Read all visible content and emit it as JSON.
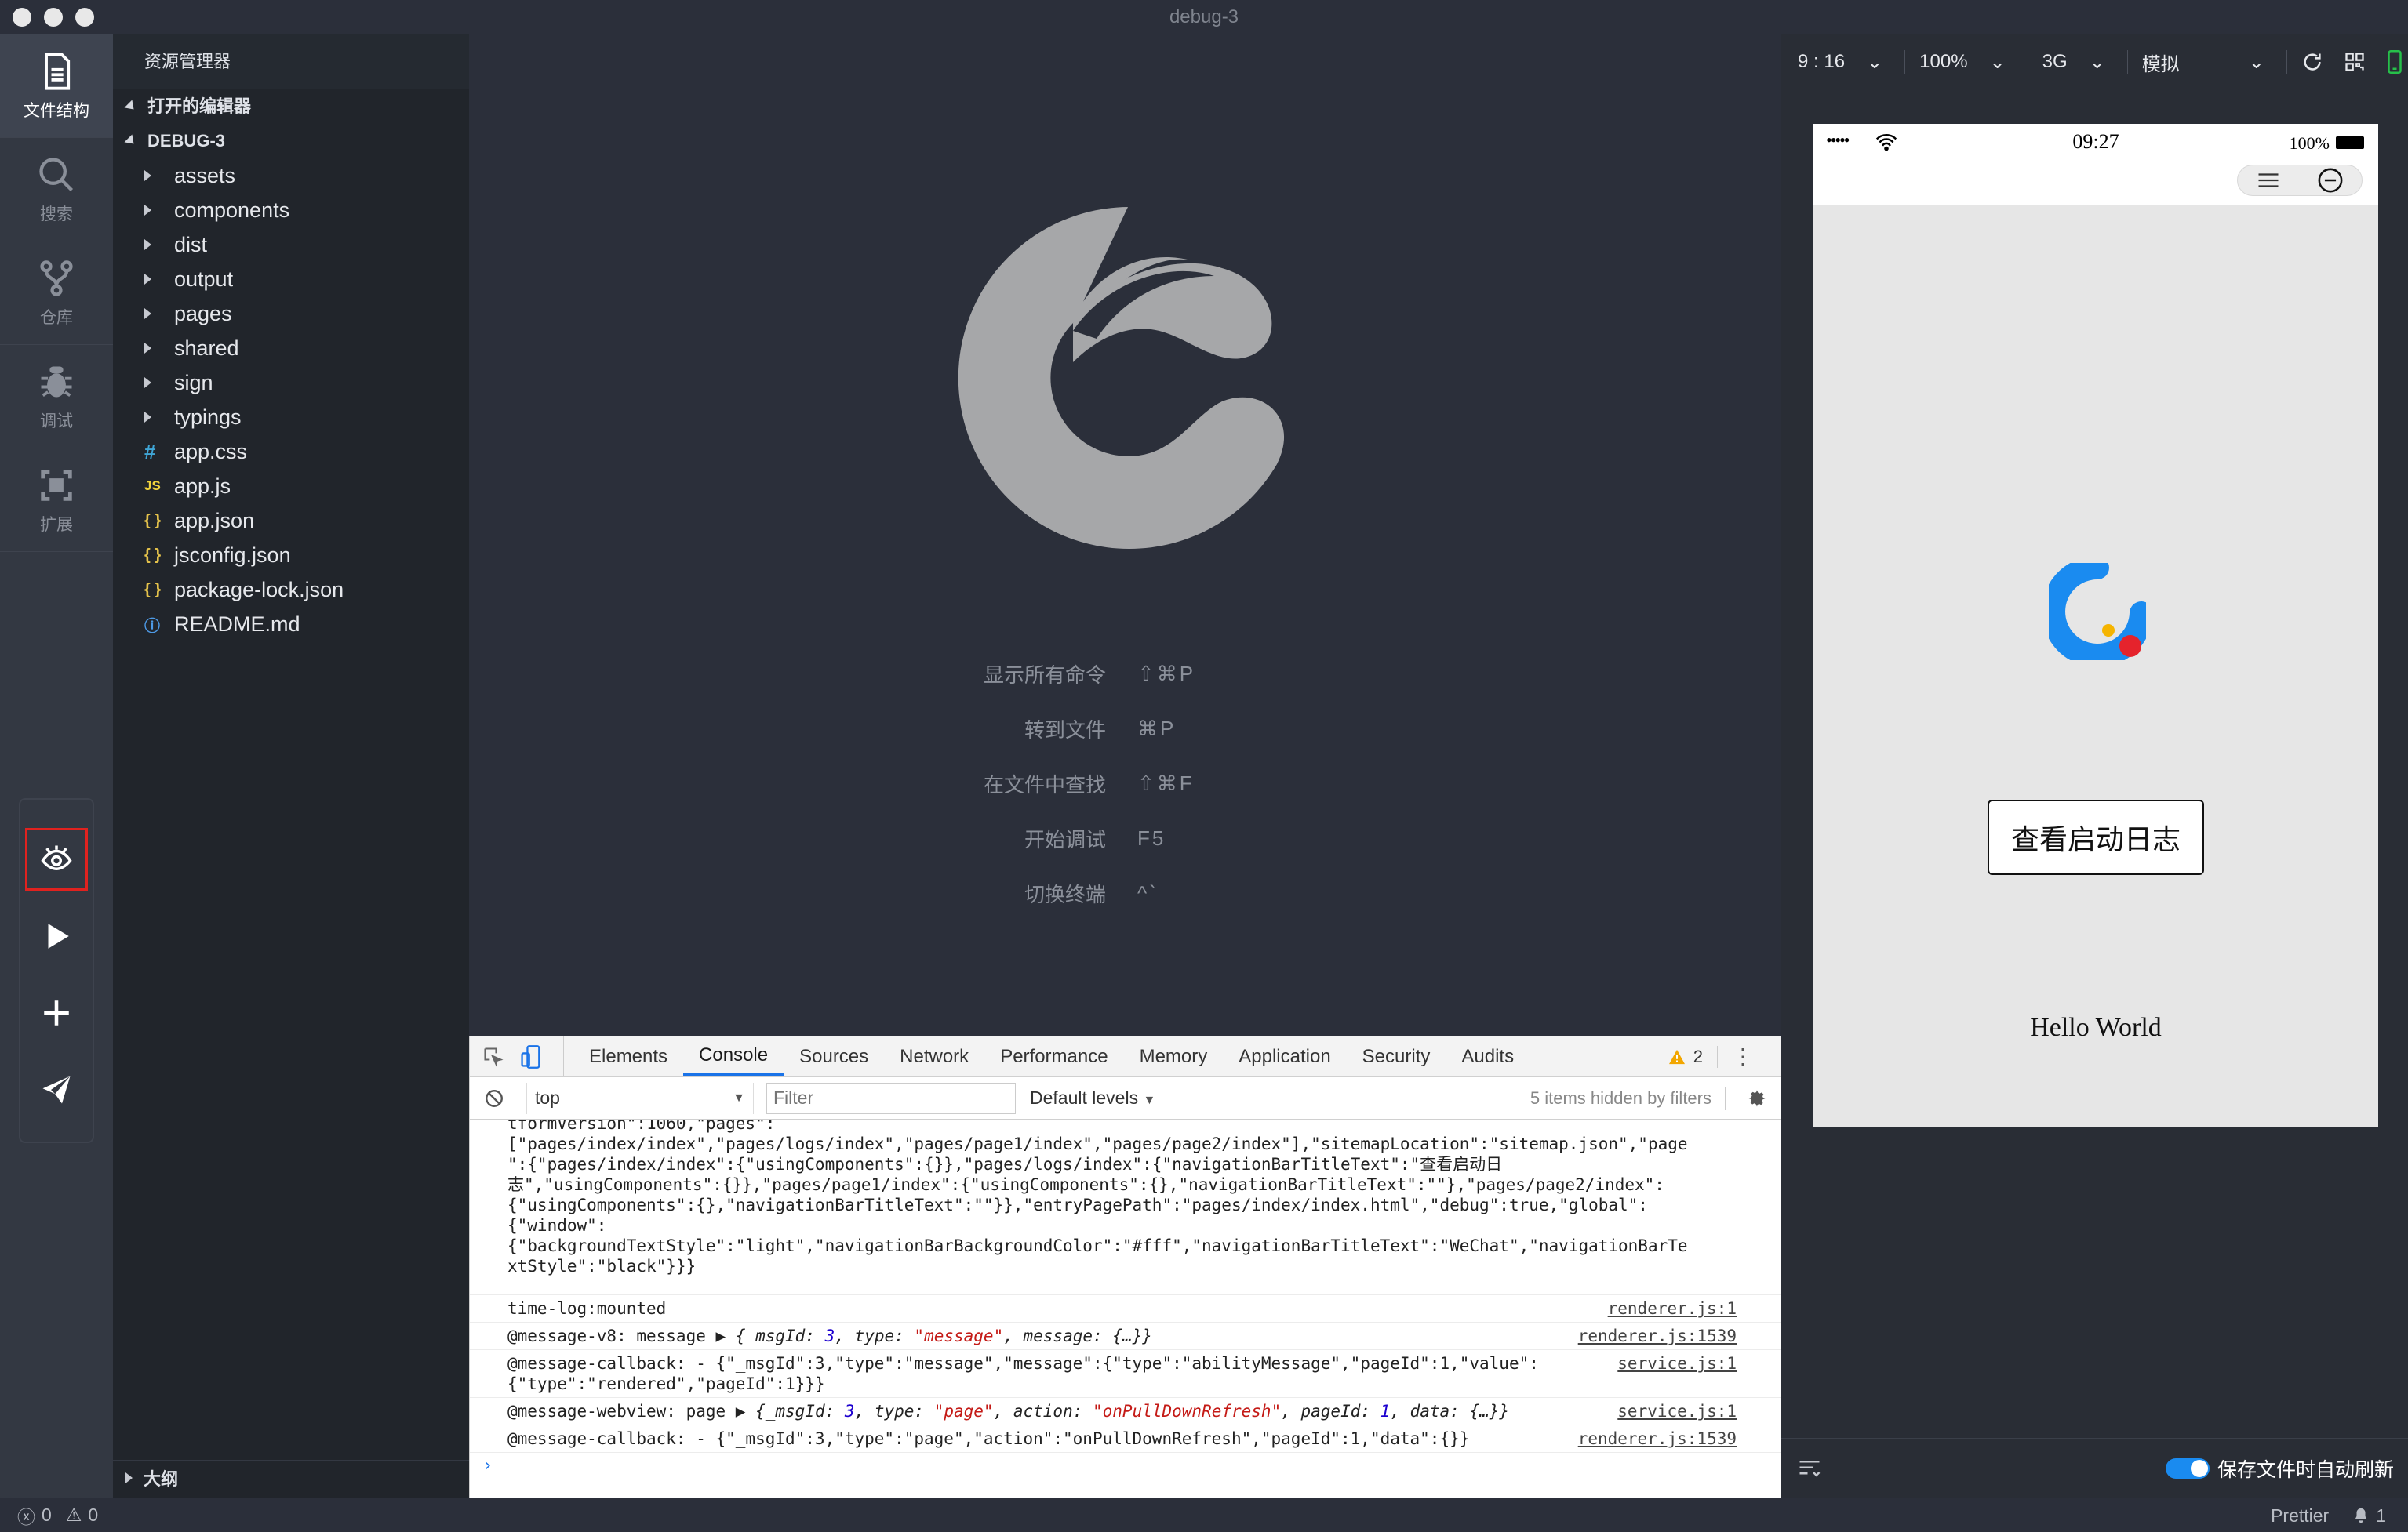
{
  "window": {
    "title": "debug-3"
  },
  "activity_bar": {
    "items": [
      {
        "label": "文件结构",
        "icon": "file-icon"
      },
      {
        "label": "搜索",
        "icon": "search-icon"
      },
      {
        "label": "仓库",
        "icon": "branch-icon"
      },
      {
        "label": "调试",
        "icon": "bug-icon"
      },
      {
        "label": "扩展",
        "icon": "extension-icon"
      }
    ],
    "tools": [
      "eye-icon",
      "play-icon",
      "plus-icon",
      "send-icon"
    ]
  },
  "explorer": {
    "header": "资源管理器",
    "open_editors": "打开的编辑器",
    "project": "DEBUG-3",
    "folders": [
      "assets",
      "components",
      "dist",
      "output",
      "pages",
      "shared",
      "sign",
      "typings"
    ],
    "files": [
      {
        "name": "app.css",
        "badge": "#"
      },
      {
        "name": "app.js",
        "badge": "JS"
      },
      {
        "name": "app.json",
        "badge": "{ }"
      },
      {
        "name": "jsconfig.json",
        "badge": "{ }"
      },
      {
        "name": "package-lock.json",
        "badge": "{ }"
      },
      {
        "name": "README.md",
        "badge": "ⓘ"
      }
    ],
    "outline": "大纲"
  },
  "welcome": {
    "commands": [
      {
        "label": "显示所有命令",
        "key": "⇧⌘P"
      },
      {
        "label": "转到文件",
        "key": "⌘P"
      },
      {
        "label": "在文件中查找",
        "key": "⇧⌘F"
      },
      {
        "label": "开始调试",
        "key": "F5"
      },
      {
        "label": "切换终端",
        "key": "^`"
      }
    ]
  },
  "devtools": {
    "tabs": [
      "Elements",
      "Console",
      "Sources",
      "Network",
      "Performance",
      "Memory",
      "Application",
      "Security",
      "Audits"
    ],
    "active_tab": "Console",
    "warning_count": "2",
    "context": "top",
    "filter_placeholder": "Filter",
    "levels": "Default levels",
    "hidden_note": "5 items hidden by filters",
    "logs": {
      "l1_a": "tformVersion\":1060,\"pages\":",
      "l1_b": "[\"pages/index/index\",\"pages/logs/index\",\"pages/page1/index\",\"pages/page2/index\"],\"sitemapLocation\":\"sitemap.json\",\"page\n\":{\"pages/index/index\":{\"usingComponents\":{}},\"pages/logs/index\":{\"navigationBarTitleText\":\"查看启动日\n志\",\"usingComponents\":{}},\"pages/page1/index\":{\"usingComponents\":{},\"navigationBarTitleText\":\"\"},\"pages/page2/index\":\n{\"usingComponents\":{},\"navigationBarTitleText\":\"\"}},\"entryPagePath\":\"pages/index/index.html\",\"debug\":true,\"global\":\n{\"window\":\n{\"backgroundTextStyle\":\"light\",\"navigationBarBackgroundColor\":\"#fff\",\"navigationBarTitleText\":\"WeChat\",\"navigationBarTe\nxtStyle\":\"black\"}}}",
      "l2_text": "time-log:mounted",
      "l2_src": "renderer.js:1",
      "l3_prefix": "@message-v8: message ▶",
      "l3_src": "renderer.js:1539",
      "l4_text": "@message-callback: - {\"_msgId\":3,\"type\":\"message\",\"message\":{\"type\":\"abilityMessage\",\"pageId\":1,\"value\":\n{\"type\":\"rendered\",\"pageId\":1}}}",
      "l4_src": "service.js:1",
      "l5_prefix": "@message-webview: page ▶",
      "l5_src": "service.js:1",
      "l6_text": "@message-callback: - {\"_msgId\":3,\"type\":\"page\",\"action\":\"onPullDownRefresh\",\"pageId\":1,\"data\":{}}",
      "l6_src": "renderer.js:1539"
    },
    "prompt": "›"
  },
  "simulator": {
    "time_setting": "9 : 16",
    "zoom": "100%",
    "network": "3G",
    "mode": "模拟",
    "phone": {
      "signal": "•••••",
      "clock": "09:27",
      "battery": "100%",
      "button": "查看启动日志",
      "hello": "Hello World"
    },
    "auto_refresh": "保存文件时自动刷新"
  },
  "status": {
    "errors": "0",
    "warnings": "0",
    "formatter": "Prettier",
    "notifications": "1"
  },
  "colors": {
    "accent": "#1a8bf0",
    "highlight_box": "#e0221f",
    "logo_blue": "#1a8bf0",
    "logo_red": "#e5232c",
    "logo_yellow": "#f5b400"
  }
}
